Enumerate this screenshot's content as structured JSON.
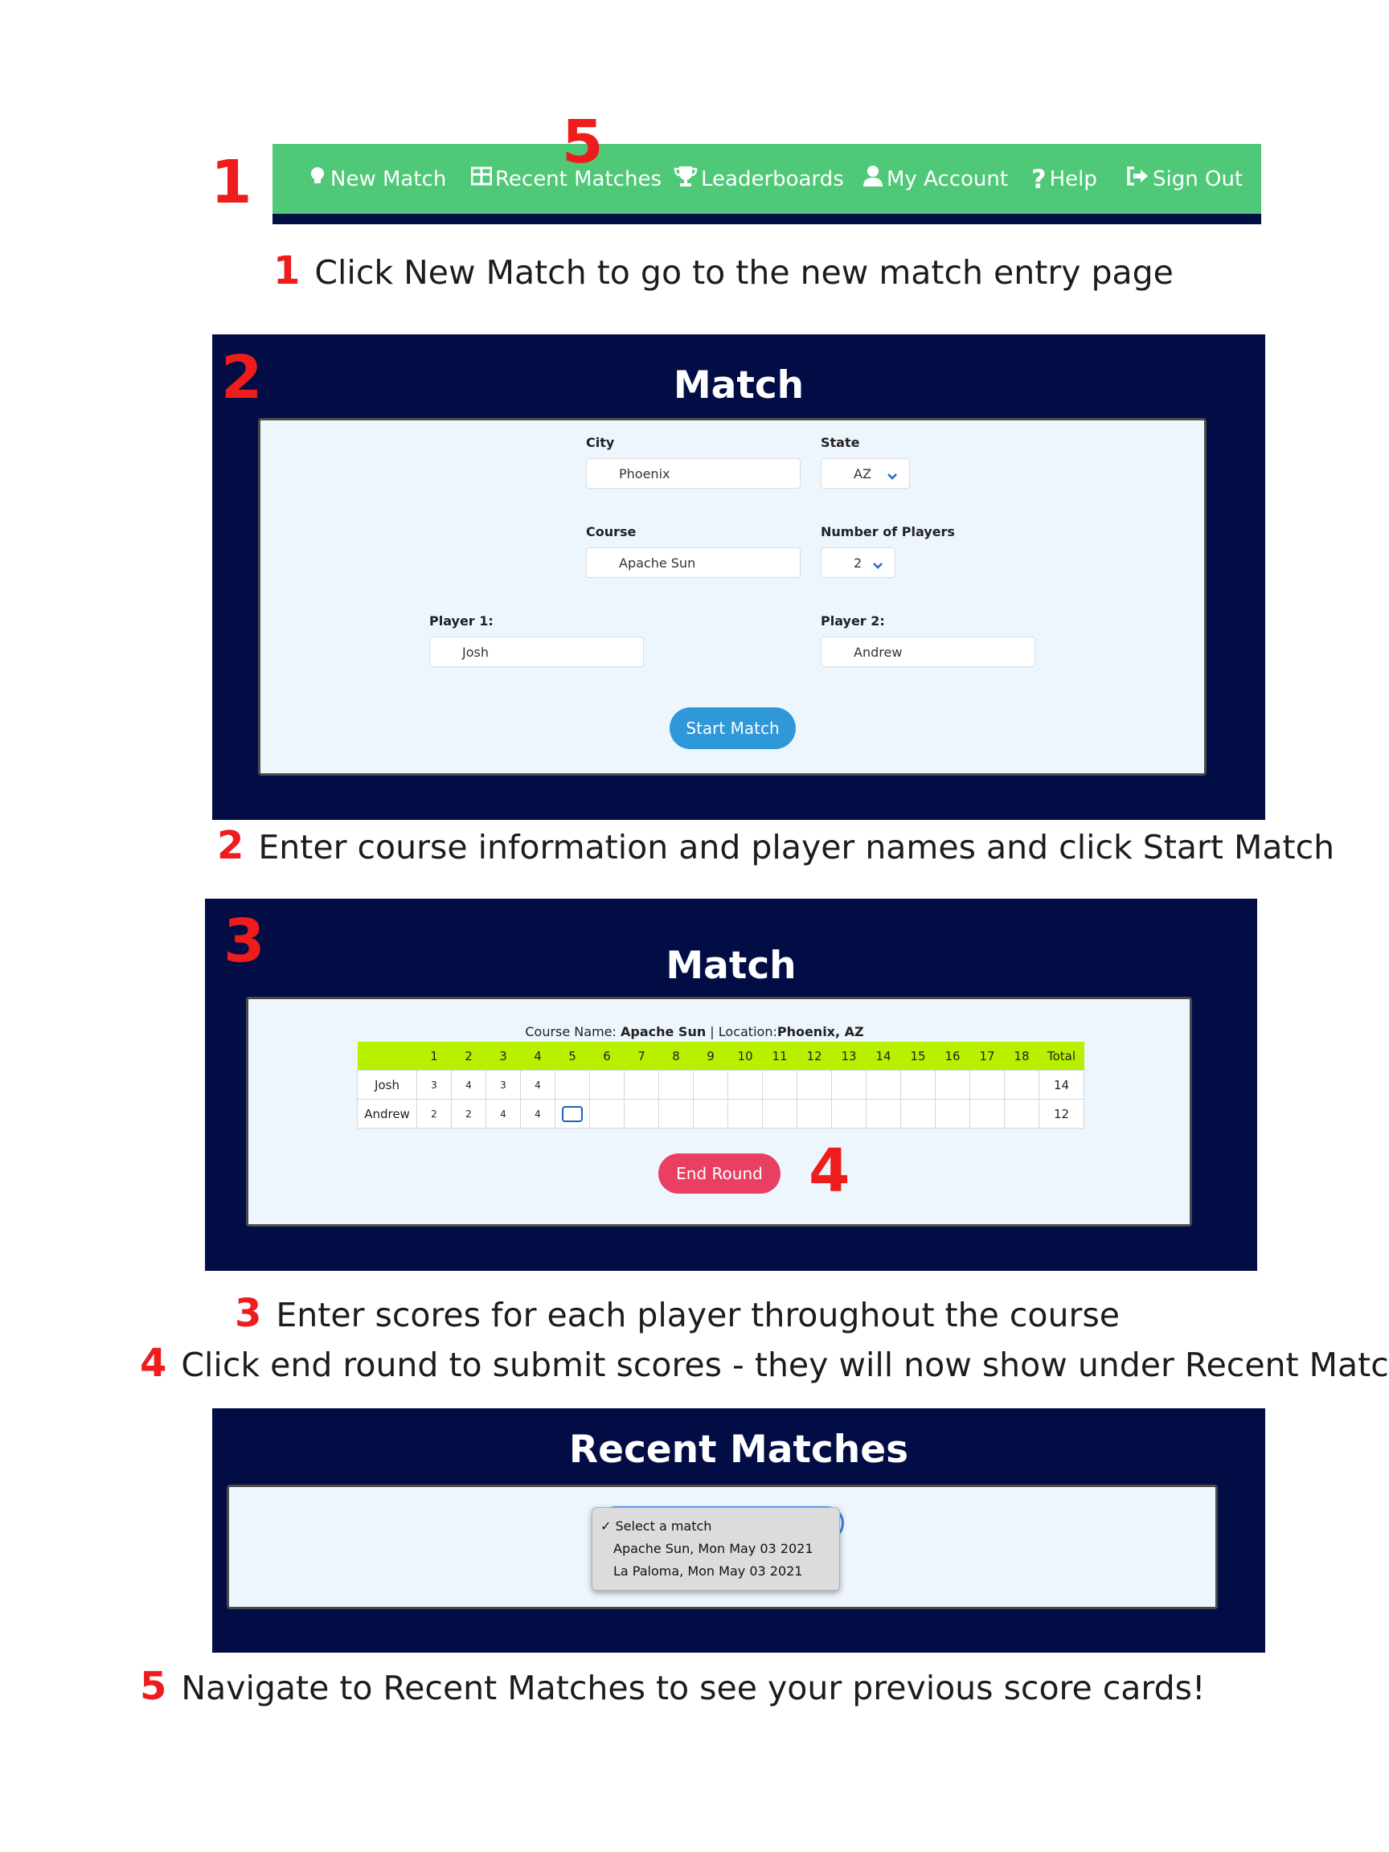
{
  "step_numbers": {
    "nav_1": "1",
    "nav_5": "5",
    "panel_2": "2",
    "panel_3": "3",
    "panel_4": "4"
  },
  "nav": {
    "items": [
      {
        "label": "New Match",
        "icon": "lightbulb-icon"
      },
      {
        "label": "Recent Matches",
        "icon": "table-icon"
      },
      {
        "label": "Leaderboards",
        "icon": "trophy-icon"
      },
      {
        "label": "My Account",
        "icon": "user-icon"
      },
      {
        "label": "Help",
        "icon": "question-icon"
      },
      {
        "label": "Sign Out",
        "icon": "sign-out-icon"
      }
    ],
    "colors": {
      "bar": "#4fc977",
      "underline": "#020d45"
    }
  },
  "captions": {
    "c1": {
      "num": "1",
      "text": "Click New Match to go to the new match entry page"
    },
    "c2": {
      "num": "2",
      "text": "Enter course information and player names and click Start Match"
    },
    "c3": {
      "num": "3",
      "text": "Enter scores for each player throughout the course"
    },
    "c4": {
      "num": "4",
      "text": "Click end round to submit scores - they will now show under Recent Matches"
    },
    "c5": {
      "num": "5",
      "text": "Navigate to Recent Matches to see your previous score cards!"
    }
  },
  "match_form": {
    "title": "Match",
    "city_label": "City",
    "city_value": "Phoenix",
    "state_label": "State",
    "state_value": "AZ",
    "course_label": "Course",
    "course_value": "Apache Sun",
    "players_label": "Number of Players",
    "players_value": "2",
    "player1_label": "Player 1:",
    "player1_value": "Josh",
    "player2_label": "Player 2:",
    "player2_value": "Andrew",
    "start_button": "Start Match"
  },
  "scorecard": {
    "title": "Match",
    "course_name_label": "Course Name: ",
    "course_name": "Apache Sun",
    "location_label": " | Location:",
    "location": "Phoenix, AZ",
    "holes": [
      "1",
      "2",
      "3",
      "4",
      "5",
      "6",
      "7",
      "8",
      "9",
      "10",
      "11",
      "12",
      "13",
      "14",
      "15",
      "16",
      "17",
      "18"
    ],
    "total_label": "Total",
    "rows": [
      {
        "name": "Josh",
        "scores": [
          "3",
          "4",
          "3",
          "4",
          "",
          "",
          "",
          "",
          "",
          "",
          "",
          "",
          "",
          "",
          "",
          "",
          "",
          ""
        ],
        "total": "14"
      },
      {
        "name": "Andrew",
        "scores": [
          "2",
          "2",
          "4",
          "4",
          "",
          "",
          "",
          "",
          "",
          "",
          "",
          "",
          "",
          "",
          "",
          "",
          "",
          ""
        ],
        "total": "12"
      }
    ],
    "end_button": "End Round"
  },
  "recent": {
    "title": "Recent Matches",
    "options": [
      "Select a match",
      "Apache Sun, Mon May 03 2021",
      "La Paloma, Mon May 03 2021"
    ],
    "selected_mark": "✓"
  }
}
